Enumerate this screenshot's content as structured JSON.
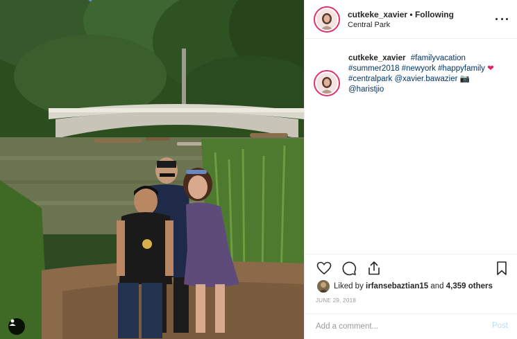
{
  "post": {
    "username": "cutkeke_xavier",
    "separator": "•",
    "follow_status": "Following",
    "location": "Central Park",
    "more_icon": "more-options-icon"
  },
  "caption": {
    "username": "cutkeke_xavier",
    "tokens": [
      {
        "type": "tag",
        "text": "#familyvacation"
      },
      {
        "type": "tag",
        "text": "#summer2018"
      },
      {
        "type": "tag",
        "text": "#newyork"
      },
      {
        "type": "tag",
        "text": "#happyfamily"
      },
      {
        "type": "emoji",
        "text": "❤"
      },
      {
        "type": "tag",
        "text": "#centralpark"
      },
      {
        "type": "tag",
        "text": "@xavier.bawazier"
      },
      {
        "type": "emoji",
        "text": "📷"
      },
      {
        "type": "tag",
        "text": "@haristjio"
      }
    ]
  },
  "actions": {
    "like_icon": "heart-icon",
    "comment_icon": "comment-icon",
    "share_icon": "share-icon",
    "save_icon": "bookmark-icon"
  },
  "likes": {
    "prefix": "Liked by",
    "user": "irfansebaztian15",
    "joiner": "and",
    "count": "4,359 others"
  },
  "date": "JUNE 29, 2018",
  "comment": {
    "placeholder": "Add a comment...",
    "post_label": "Post"
  },
  "colors": {
    "hashtag": "#003569",
    "story_ring": "#e1306c",
    "post_disabled": "#b2dffc"
  }
}
